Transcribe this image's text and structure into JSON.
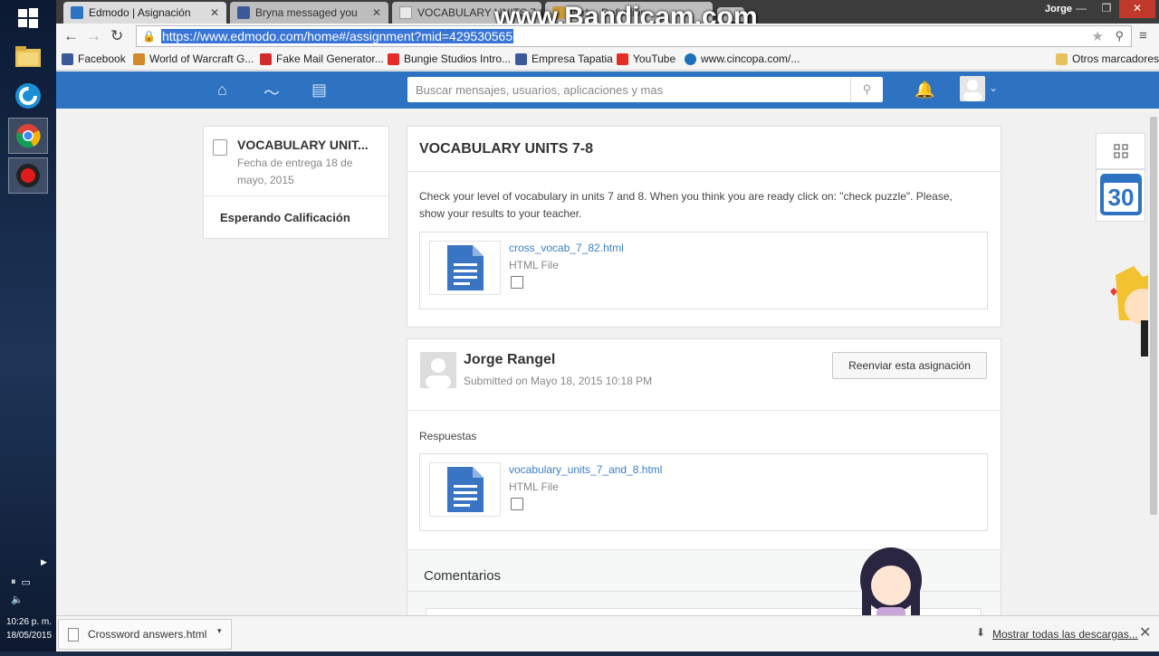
{
  "browser": {
    "tabs": [
      {
        "title": "Edmodo | Asignación",
        "favicon_color": "#2d73c2"
      },
      {
        "title": "Bryna messaged you",
        "favicon_color": "#3b5998"
      },
      {
        "title": "VOCABULARY UNITS 7-8",
        "favicon_color": "#cccccc"
      },
      {
        "title": "verb - Definition",
        "favicon_color": "#c89b3c"
      }
    ],
    "user": "Jorge",
    "url": "https://www.edmodo.com/home#/assignment?mid=429530565",
    "watermark": "www.Bandicam.com",
    "bookmarks": [
      {
        "label": "Facebook",
        "icon": "facebook-icon",
        "color": "#3b5998"
      },
      {
        "label": "World of Warcraft G...",
        "icon": "wow-icon",
        "color": "#d08a2a"
      },
      {
        "label": "Fake Mail Generator...",
        "icon": "fake-mail-icon",
        "color": "#d22b2b"
      },
      {
        "label": "Bungie Studios Intro...",
        "icon": "youtube-icon",
        "color": "#e52d27"
      },
      {
        "label": "Empresa Tapatia",
        "icon": "facebook-icon",
        "color": "#3b5998"
      },
      {
        "label": "YouTube",
        "icon": "youtube-icon",
        "color": "#e52d27"
      },
      {
        "label": "www.cincopa.com/...",
        "icon": "cincopa-icon",
        "color": "#1e6fb5"
      }
    ],
    "other_bookmarks": "Otros marcadores"
  },
  "edmodo": {
    "search_placeholder": "Buscar mensajes, usuarios, aplicaciones y mas",
    "brand_color": "#2d73c2",
    "sidebar": {
      "title": "VOCABULARY UNIT...",
      "due_line1": "Fecha de entrega 18 de",
      "due_line2": "mayo, 2015",
      "status": "Esperando Calificación"
    },
    "assignment": {
      "title": "VOCABULARY UNITS 7-8",
      "description_line1": "Check your level of vocabulary in units 7 and 8. When you think you are ready click on: \"check puzzle\". Please,",
      "description_line2": "show your results to your teacher.",
      "file": {
        "name": "cross_vocab_7_82.html",
        "type": "HTML File"
      }
    },
    "submission": {
      "student": "Jorge Rangel",
      "submitted": "Submitted on Mayo 18, 2015 10:18 PM",
      "resend_button": "Reenviar esta asignación",
      "responses_label": "Respuestas",
      "file": {
        "name": "vocabulary_units_7_and_8.html",
        "type": "HTML File"
      },
      "comments_label": "Comentarios"
    },
    "calendar_day": "30"
  },
  "downloads": {
    "file": "Crossword answers.html",
    "show_all": "Mostrar todas las descargas..."
  },
  "taskbar": {
    "time": "10:26 p. m.",
    "date": "18/05/2015"
  }
}
